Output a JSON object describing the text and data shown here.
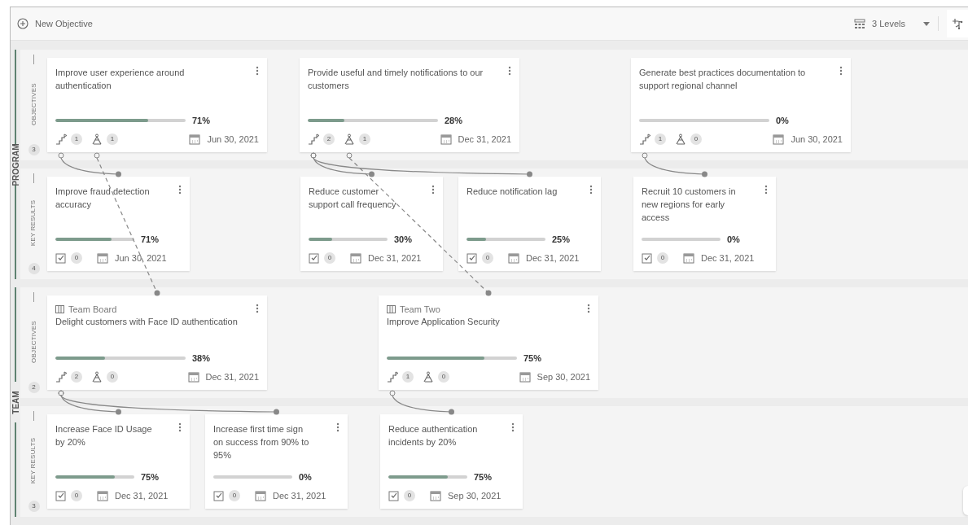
{
  "toolbar": {
    "new_button": "New Objective",
    "levels": "3 Levels"
  },
  "groups": [
    {
      "label": "PROGRAM",
      "lanes": [
        {
          "kind": "objectives",
          "label": "OBJECTIVES",
          "count": "3",
          "cards": [
            {
              "title": "Improve user experience around authentication",
              "level": 0.71,
              "percent": "71%",
              "key_results": "1",
              "alignments": "1",
              "due": "Jun 30, 2021"
            },
            {
              "title": "Provide useful and timely notifications to our customers",
              "level": 0.28,
              "percent": "28%",
              "key_results": "2",
              "alignments": "1",
              "due": "Dec 31, 2021"
            },
            {
              "title": "Generate best practices documentation to support regional channel",
              "level": 0,
              "percent": "0%",
              "key_results": "1",
              "alignments": "0",
              "due": "Jun 30, 2021"
            }
          ]
        },
        {
          "kind": "key_results",
          "label": "KEY RESULTS",
          "count": "4",
          "cards": [
            {
              "title": "Improve fraud detection accuracy",
              "level": 0.71,
              "percent": "71%",
              "tasks": "0",
              "due": "Jun 30, 2021"
            },
            {
              "title": "Reduce customer support call frequency",
              "level": 0.3,
              "percent": "30%",
              "tasks": "0",
              "due": "Dec 31, 2021"
            },
            {
              "title": "Reduce notification lag",
              "level": 0.25,
              "percent": "25%",
              "tasks": "0",
              "due": "Dec 31, 2021"
            },
            {
              "title": "Recruit 10 customers in new regions for early access",
              "level": 0,
              "percent": "0%",
              "tasks": "0",
              "due": "Dec 31, 2021"
            }
          ]
        }
      ]
    },
    {
      "label": "TEAM",
      "lanes": [
        {
          "kind": "objectives",
          "label": "OBJECTIVES",
          "count": "2",
          "cards": [
            {
              "team": "Team Board",
              "title": "Delight customers with Face ID authentication",
              "level": 0.38,
              "percent": "38%",
              "key_results": "2",
              "alignments": "0",
              "due": "Dec 31, 2021"
            },
            {
              "team": "Team Two",
              "title": "Improve Application Security",
              "level": 0.75,
              "percent": "75%",
              "key_results": "1",
              "alignments": "0",
              "due": "Sep 30, 2021"
            }
          ]
        },
        {
          "kind": "key_results",
          "label": "KEY RESULTS",
          "count": "3",
          "cards": [
            {
              "title": "Increase Face ID Usage by 20%",
              "level": 0.75,
              "percent": "75%",
              "tasks": "0",
              "due": "Dec 31, 2021"
            },
            {
              "title": "Increase first time sign on success from 90% to 95%",
              "level": 0,
              "percent": "0%",
              "tasks": "0",
              "due": "Dec 31, 2021"
            },
            {
              "title": "Reduce authentication incidents by 20%",
              "level": 0.75,
              "percent": "75%",
              "tasks": "0",
              "due": "Sep 30, 2021"
            }
          ]
        }
      ]
    }
  ]
}
